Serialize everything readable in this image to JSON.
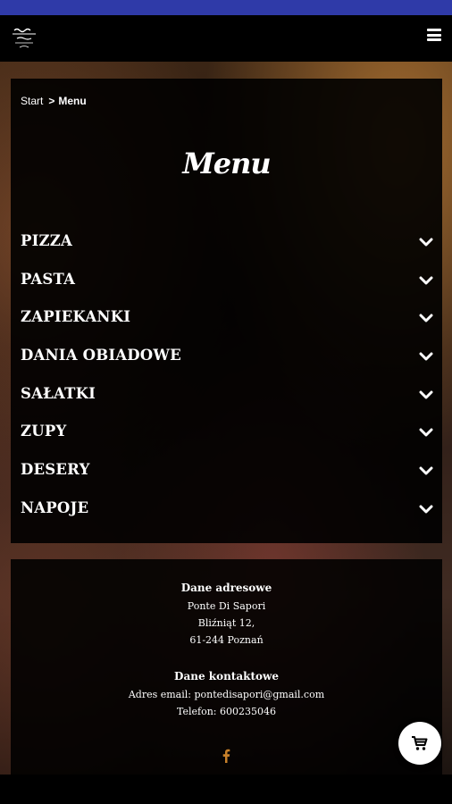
{
  "breadcrumb": {
    "start": "Start",
    "separator": ">",
    "current": "Menu"
  },
  "page_title": "Menu",
  "categories": [
    {
      "label": "PIZZA"
    },
    {
      "label": "PASTA"
    },
    {
      "label": "ZAPIEKANKI"
    },
    {
      "label": "DANIA OBIADOWE"
    },
    {
      "label": "SAŁATKI"
    },
    {
      "label": "ZUPY"
    },
    {
      "label": "DESERY"
    },
    {
      "label": "NAPOJE"
    }
  ],
  "footer": {
    "address_heading": "Dane adresowe",
    "address_lines": [
      "Ponte Di Sapori",
      "Bliźniąt 12,",
      "61-244 Poznań"
    ],
    "contact_heading": "Dane kontaktowe",
    "email_line": "Adres email: pontedisapori@gmail.com",
    "phone_line": "Telefon: 600235046"
  },
  "icons": {
    "menu": "hamburger-icon",
    "category_toggle": "chevron-down-icon",
    "social": "facebook-icon",
    "cart": "cart-icon"
  },
  "colors": {
    "status_bar": "#2f3aa8",
    "facebook_icon": "#c7802a"
  }
}
